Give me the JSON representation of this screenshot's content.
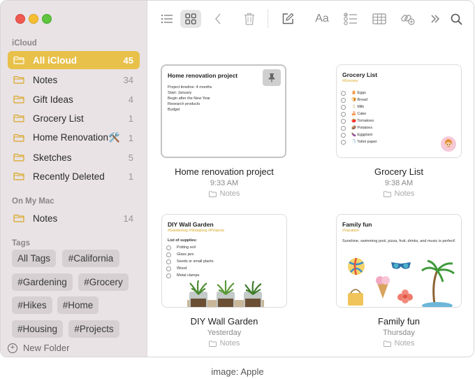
{
  "sidebar": {
    "icloud_header": "iCloud",
    "icloud_folders": [
      {
        "name": "All iCloud",
        "count": "45"
      },
      {
        "name": "Notes",
        "count": "34"
      },
      {
        "name": "Gift Ideas",
        "count": "4"
      },
      {
        "name": "Grocery List",
        "count": "1"
      },
      {
        "name": "Home Renovation🛠️",
        "count": "1"
      },
      {
        "name": "Sketches",
        "count": "5"
      },
      {
        "name": "Recently Deleted",
        "count": "1"
      }
    ],
    "mac_header": "On My Mac",
    "mac_folders": [
      {
        "name": "Notes",
        "count": "14"
      }
    ],
    "tags_header": "Tags",
    "tags": [
      "All Tags",
      "#California",
      "#Gardening",
      "#Grocery",
      "#Hikes",
      "#Home",
      "#Housing",
      "#Projects"
    ],
    "new_folder": "New Folder"
  },
  "notes": [
    {
      "title": "Home renovation project",
      "time": "9:33 AM",
      "folder": "Notes",
      "preview_title": "Home renovation project",
      "preview_lines": [
        "Project timeline: 4 months",
        "Start: January",
        "Begin after the New Year",
        "Research products",
        "Budget"
      ]
    },
    {
      "title": "Grocery List",
      "time": "9:38 AM",
      "folder": "Notes",
      "preview_title": "Grocery List",
      "preview_tag": "#Grocery",
      "preview_items": [
        "🥚 Eggs",
        "🍞 Bread",
        "🥛 Milk",
        "🍰 Cake",
        "🍅 Tomatoes",
        "🥔 Potatoes",
        "🍆 Eggplant",
        "🧻 Toilet paper"
      ]
    },
    {
      "title": "DIY Wall Garden",
      "time": "Yesterday",
      "folder": "Notes",
      "preview_title": "DIY Wall Garden",
      "preview_tag": "#Gardening #Shopping #Projects",
      "preview_subhead": "List of supplies:",
      "preview_items": [
        "Potting soil",
        "Glass jars",
        "Seeds or small plants",
        "Wood",
        "Metal clamps"
      ]
    },
    {
      "title": "Family fun",
      "time": "Thursday",
      "folder": "Notes",
      "preview_title": "Family fun",
      "preview_tag": "#Vacation",
      "preview_text": "Sunshine, swimming pool, pizza, fruit, drinks, and music is perfect!"
    }
  ],
  "credit": "image: Apple"
}
